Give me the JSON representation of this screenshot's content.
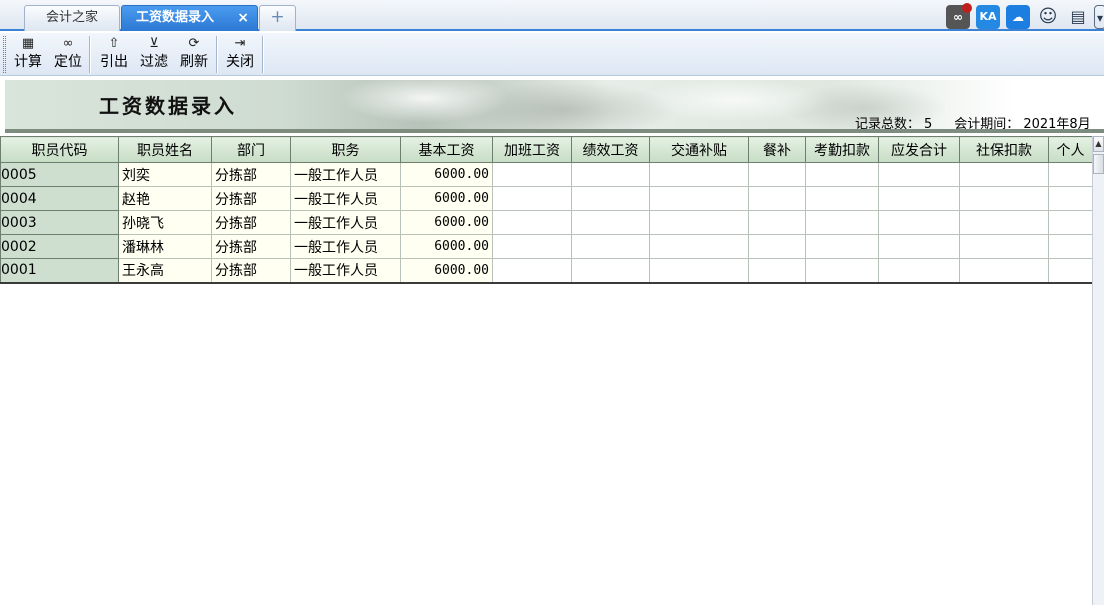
{
  "tabs": [
    {
      "label": "会计之家"
    },
    {
      "label": "工资数据录入",
      "close": "×"
    },
    {
      "label": "+"
    }
  ],
  "topright_icons": [
    "link-icon",
    "ka-icon",
    "cloud-icon",
    "smile-icon",
    "message-icon",
    "dropdown-icon"
  ],
  "topright": {
    "ka": "KA"
  },
  "toolbar": {
    "items": [
      {
        "label": "计算",
        "icon": "calculator-icon"
      },
      {
        "label": "定位",
        "icon": "binoculars-icon"
      },
      {
        "label": "引出",
        "icon": "export-icon"
      },
      {
        "label": "过滤",
        "icon": "filter-icon"
      },
      {
        "label": "刷新",
        "icon": "refresh-icon"
      },
      {
        "label": "关闭",
        "icon": "exit-icon"
      }
    ]
  },
  "banner": {
    "title": "工资数据录入",
    "record_count_label": "记录总数：",
    "record_count": "5",
    "period_label": "会计期间：",
    "period": "2021年8月"
  },
  "grid": {
    "columns": [
      "职员代码",
      "职员姓名",
      "部门",
      "职务",
      "基本工资",
      "加班工资",
      "绩效工资",
      "交通补贴",
      "餐补",
      "考勤扣款",
      "应发合计",
      "社保扣款",
      "个人"
    ],
    "rows": [
      {
        "code": "0005",
        "name": "刘奕",
        "dept": "分拣部",
        "position": "一般工作人员",
        "base": "6000.00"
      },
      {
        "code": "0004",
        "name": "赵艳",
        "dept": "分拣部",
        "position": "一般工作人员",
        "base": "6000.00"
      },
      {
        "code": "0003",
        "name": "孙晓飞",
        "dept": "分拣部",
        "position": "一般工作人员",
        "base": "6000.00"
      },
      {
        "code": "0002",
        "name": "潘琳林",
        "dept": "分拣部",
        "position": "一般工作人员",
        "base": "6000.00"
      },
      {
        "code": "0001",
        "name": "王永高",
        "dept": "分拣部",
        "position": "一般工作人员",
        "base": "6000.00"
      }
    ]
  },
  "colors": {
    "tab_active": "#2c78d4",
    "header_green": "#c7dcc5",
    "code_col": "#cfdfcf",
    "cell_yellow": "#fffff2"
  }
}
